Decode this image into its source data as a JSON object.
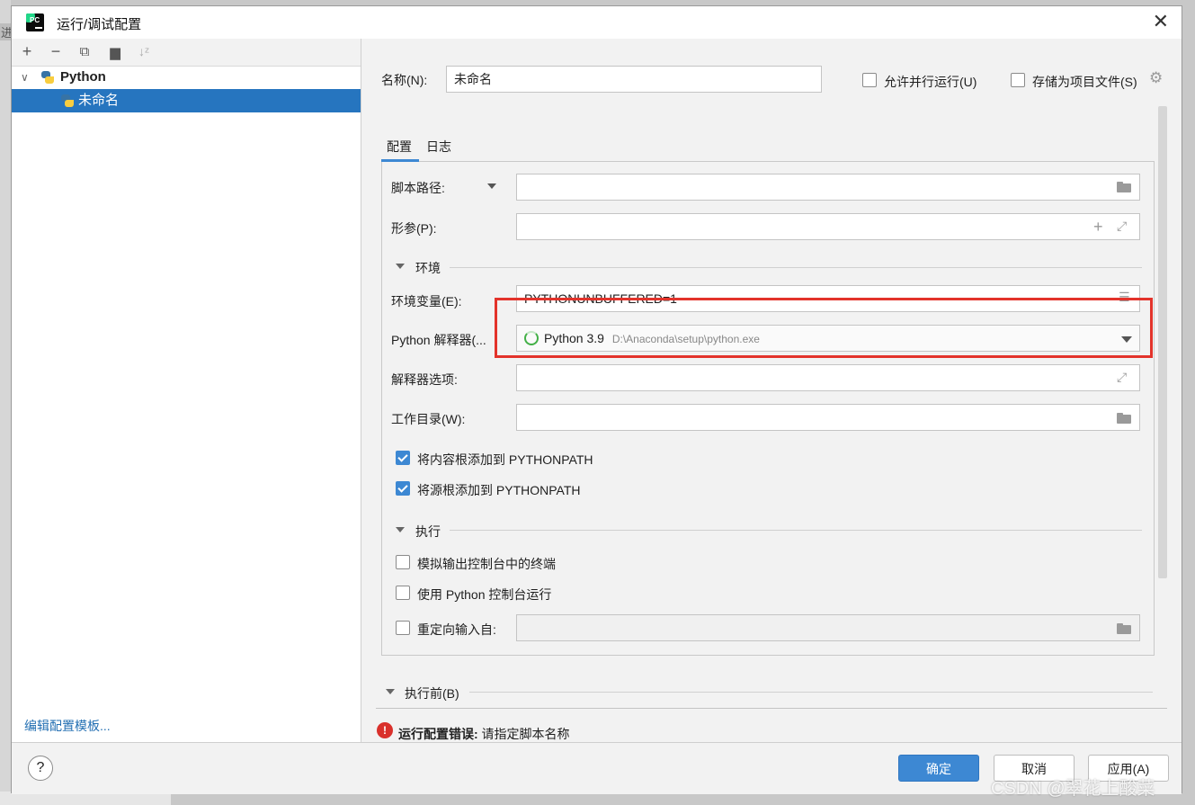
{
  "background": {
    "side_text": "进"
  },
  "window": {
    "title": "运行/调试配置",
    "accent": "#3d88d3"
  },
  "tree": {
    "group": "Python",
    "item": "未命名"
  },
  "left": {
    "edit_templates": "编辑配置模板..."
  },
  "form": {
    "name_label": "名称(N):",
    "name_value": "未命名",
    "allow_parallel": "允许并行运行(U)",
    "store_as_file": "存储为项目文件(S)",
    "tabs": [
      "配置",
      "日志"
    ],
    "script_label": "脚本路径:",
    "params_label": "形参(P):",
    "env_section": "环境",
    "env_vars_label": "环境变量(E):",
    "env_vars_value": "PYTHONUNBUFFERED=1",
    "interpreter_label": "Python 解释器(...",
    "interpreter_name": "Python 3.9",
    "interpreter_path": "D:\\Anaconda\\setup\\python.exe",
    "interp_options_label": "解释器选项:",
    "workdir_label": "工作目录(W):",
    "add_content_roots": "将内容根添加到 PYTHONPATH",
    "add_source_roots": "将源根添加到 PYTHONPATH",
    "exec_section": "执行",
    "emulate_terminal": "模拟输出控制台中的终端",
    "use_console": "使用 Python 控制台运行",
    "redirect_input": "重定向输入自:",
    "before_launch": "执行前(B)"
  },
  "error": {
    "title": "运行配置错误:",
    "message": " 请指定脚本名称"
  },
  "buttons": {
    "ok": "确定",
    "cancel": "取消",
    "apply": "应用(A)",
    "help": "?"
  },
  "watermark": "CSDN @翠花上酸菜"
}
